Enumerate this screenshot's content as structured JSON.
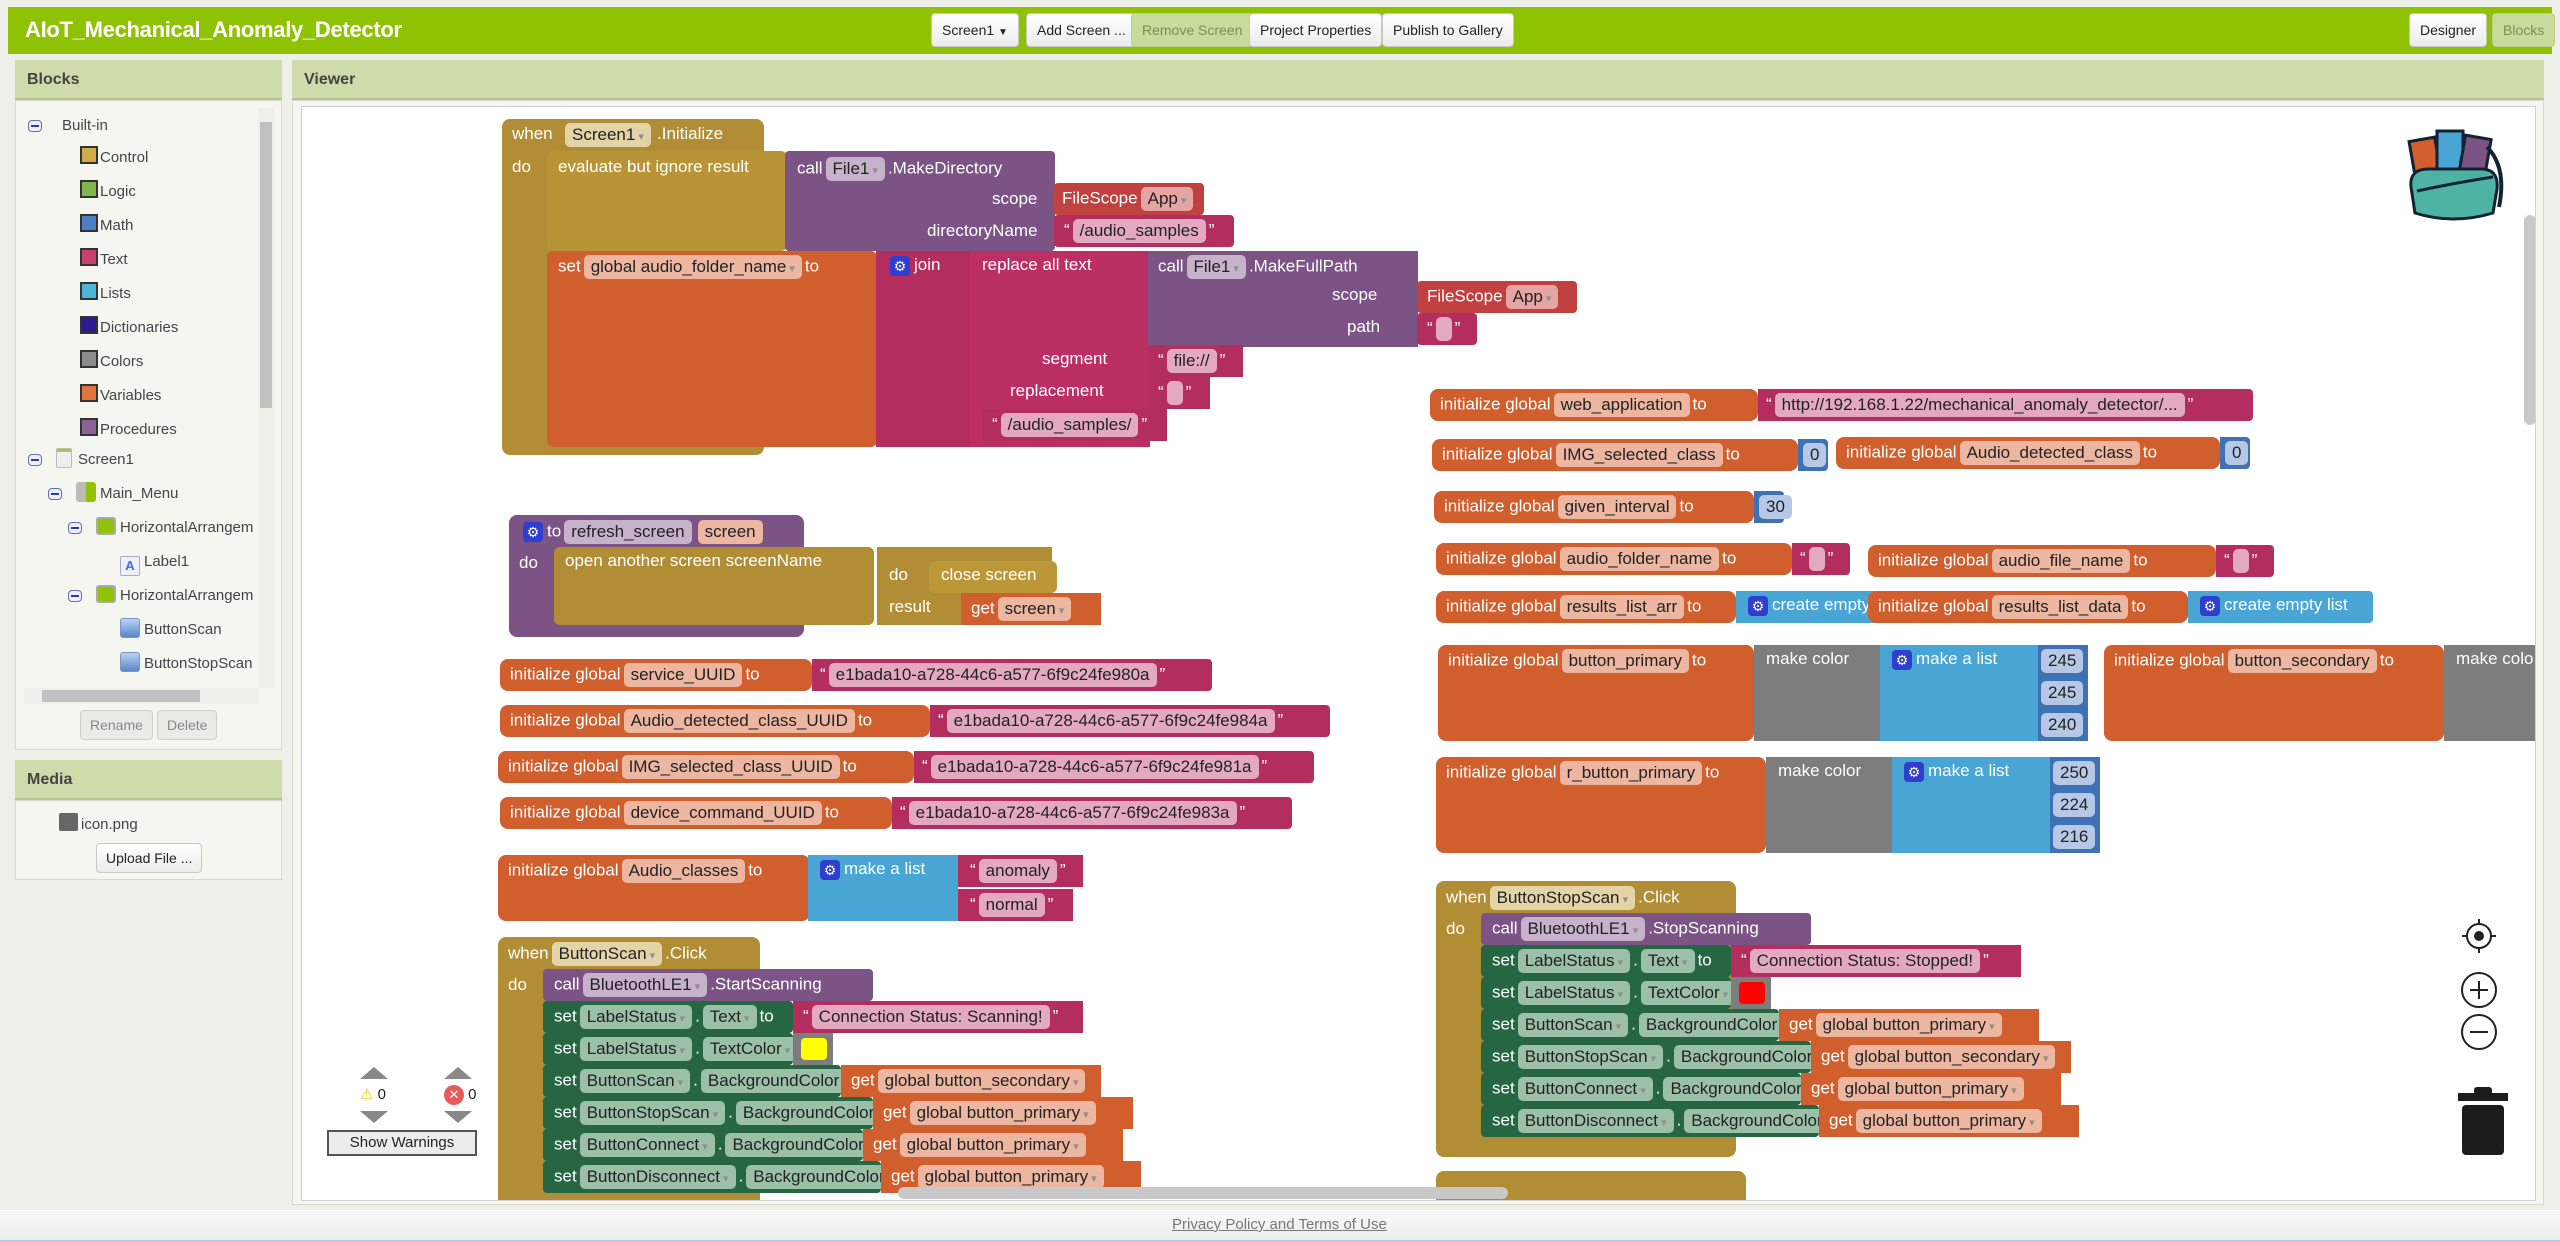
{
  "app": {
    "title": "AIoT_Mechanical_Anomaly_Detector"
  },
  "toolbar": {
    "screen_select": "Screen1",
    "add_screen": "Add Screen ...",
    "remove_screen": "Remove Screen",
    "project_properties": "Project Properties",
    "publish": "Publish to Gallery",
    "designer": "Designer",
    "blocks": "Blocks"
  },
  "blocks_panel": {
    "title": "Blocks",
    "builtin_label": "Built-in",
    "builtin": [
      {
        "label": "Control",
        "color": "#d1ab47"
      },
      {
        "label": "Logic",
        "color": "#84b54c"
      },
      {
        "label": "Math",
        "color": "#4a80c1"
      },
      {
        "label": "Text",
        "color": "#c4426c"
      },
      {
        "label": "Lists",
        "color": "#4eb3d9"
      },
      {
        "label": "Dictionaries",
        "color": "#2c1a8f"
      },
      {
        "label": "Colors",
        "color": "#8c8c8c"
      },
      {
        "label": "Variables",
        "color": "#e0743a"
      },
      {
        "label": "Procedures",
        "color": "#8d6297"
      }
    ],
    "components": [
      {
        "label": "Screen1"
      },
      {
        "label": "Main_Menu"
      },
      {
        "label": "HorizontalArrangem"
      },
      {
        "label": "Label1"
      },
      {
        "label": "HorizontalArrangem"
      },
      {
        "label": "ButtonScan"
      },
      {
        "label": "ButtonStopScan"
      }
    ],
    "rename": "Rename",
    "delete": "Delete"
  },
  "media_panel": {
    "title": "Media",
    "file": "icon.png",
    "upload": "Upload File ..."
  },
  "viewer": {
    "title": "Viewer",
    "warnings_count": "0",
    "errors_count": "0",
    "show_warnings": "Show Warnings"
  },
  "blocks": {
    "init": {
      "when": "when",
      "component": "Screen1",
      "event": ".Initialize",
      "do": "do",
      "evaluate": "evaluate but ignore result",
      "call": "call",
      "file": "File1",
      "make_dir": ".MakeDirectory",
      "scope": "scope",
      "filescope": "FileScope",
      "app": "App",
      "dirname_label": "directoryName",
      "dirname": "/audio_samples",
      "set": "set",
      "var": "global audio_folder_name",
      "to": "to",
      "join": "join",
      "replace": "replace all text",
      "make_full_path": ".MakeFullPath",
      "path": "path",
      "segment": "segment",
      "segment_val": "file://",
      "replacement": "replacement",
      "samples": "/audio_samples/"
    },
    "refresh": {
      "to": "to",
      "name": "refresh_screen",
      "param": "screen",
      "do": "do",
      "open": "open another screen  screenName",
      "do2": "do",
      "close": "close screen",
      "result": "result",
      "get": "get",
      "get_var": "screen"
    },
    "uuids": [
      {
        "name": "service_UUID",
        "value": "e1bada10-a728-44c6-a577-6f9c24fe980a"
      },
      {
        "name": "Audio_detected_class_UUID",
        "value": "e1bada10-a728-44c6-a577-6f9c24fe984a"
      },
      {
        "name": "IMG_selected_class_UUID",
        "value": "e1bada10-a728-44c6-a577-6f9c24fe981a"
      },
      {
        "name": "device_command_UUID",
        "value": "e1bada10-a728-44c6-a577-6f9c24fe983a"
      }
    ],
    "init_global": "initialize global",
    "to": "to",
    "audio_classes": {
      "name": "Audio_classes",
      "make_list": "make a list",
      "items": [
        "anomaly",
        "normal"
      ]
    },
    "web_application": {
      "name": "web_application",
      "value": "http://192.168.1.22/mechanical_anomaly_detector/..."
    },
    "img_selected_class": {
      "name": "IMG_selected_class",
      "value": "0"
    },
    "audio_detected_class": {
      "name": "Audio_detected_class",
      "value": "0"
    },
    "given_interval": {
      "name": "given_interval",
      "value": "30"
    },
    "audio_folder_name": {
      "name": "audio_folder_name"
    },
    "audio_file_name": {
      "name": "audio_file_name"
    },
    "results_list_arr": {
      "name": "results_list_arr",
      "value": "create empty list"
    },
    "results_list_data": {
      "name": "results_list_data",
      "value": "create empty list"
    },
    "button_primary": {
      "name": "button_primary",
      "make_color": "make color",
      "make_list": "make a list",
      "rgb": [
        "245",
        "245",
        "240"
      ]
    },
    "button_secondary": {
      "name": "button_secondary",
      "make_color": "make colo"
    },
    "r_button_primary": {
      "name": "r_button_primary",
      "make_color": "make color",
      "make_list": "make a list",
      "rgb": [
        "250",
        "224",
        "216"
      ]
    },
    "scan_click": {
      "when": "when",
      "component": "ButtonScan",
      "event": ".Click",
      "do": "do",
      "call": "call",
      "ble": "BluetoothLE1",
      "method": ".StartScanning",
      "rows": [
        {
          "comp": "LabelStatus",
          "prop": "Text",
          "value": "Connection Status: Scanning!",
          "kind": "text"
        },
        {
          "comp": "LabelStatus",
          "prop": "TextColor",
          "value": "#ffff00",
          "kind": "color"
        },
        {
          "comp": "ButtonScan",
          "prop": "BackgroundColor",
          "value": "global button_secondary",
          "kind": "get"
        },
        {
          "comp": "ButtonStopScan",
          "prop": "BackgroundColor",
          "value": "global button_primary",
          "kind": "get"
        },
        {
          "comp": "ButtonConnect",
          "prop": "BackgroundColor",
          "value": "global button_primary",
          "kind": "get"
        },
        {
          "comp": "ButtonDisconnect",
          "prop": "BackgroundColor",
          "value": "global button_primary",
          "kind": "get"
        }
      ]
    },
    "stop_click": {
      "when": "when",
      "component": "ButtonStopScan",
      "event": ".Click",
      "do": "do",
      "call": "call",
      "ble": "BluetoothLE1",
      "method": ".StopScanning",
      "rows": [
        {
          "comp": "LabelStatus",
          "prop": "Text",
          "value": "Connection Status: Stopped!",
          "kind": "text"
        },
        {
          "comp": "LabelStatus",
          "prop": "TextColor",
          "value": "#ff0000",
          "kind": "color"
        },
        {
          "comp": "ButtonScan",
          "prop": "BackgroundColor",
          "value": "global button_primary",
          "kind": "get"
        },
        {
          "comp": "ButtonStopScan",
          "prop": "BackgroundColor",
          "value": "global button_secondary",
          "kind": "get"
        },
        {
          "comp": "ButtonConnect",
          "prop": "BackgroundColor",
          "value": "global button_primary",
          "kind": "get"
        },
        {
          "comp": "ButtonDisconnect",
          "prop": "BackgroundColor",
          "value": "global button_primary",
          "kind": "get"
        }
      ]
    },
    "set": "set",
    "get": "get"
  },
  "footer": {
    "privacy": "Privacy Policy and Terms of Use"
  }
}
